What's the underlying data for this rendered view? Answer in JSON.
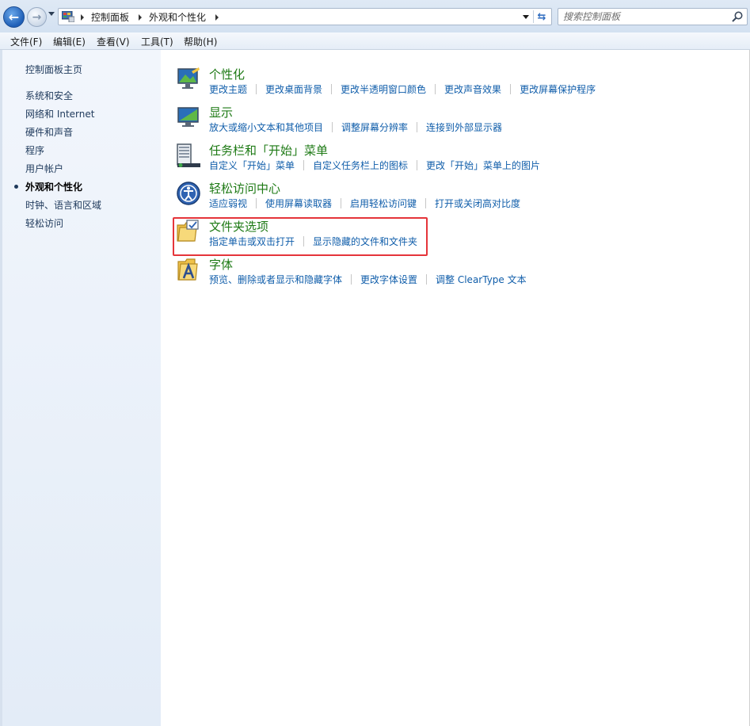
{
  "address_bar": {
    "breadcrumbs": [
      "控制面板",
      "外观和个性化"
    ],
    "search_placeholder": "搜索控制面板",
    "back_icon": "back-arrow-icon",
    "forward_icon": "forward-arrow-icon",
    "refresh_icon": "refresh-icon"
  },
  "menu": {
    "items": [
      "文件(F)",
      "编辑(E)",
      "查看(V)",
      "工具(T)",
      "帮助(H)"
    ]
  },
  "sidebar": {
    "home": "控制面板主页",
    "items": [
      {
        "label": "系统和安全",
        "active": false
      },
      {
        "label": "网络和 Internet",
        "active": false
      },
      {
        "label": "硬件和声音",
        "active": false
      },
      {
        "label": "程序",
        "active": false
      },
      {
        "label": "用户帐户",
        "active": false
      },
      {
        "label": "外观和个性化",
        "active": true
      },
      {
        "label": "时钟、语言和区域",
        "active": false
      },
      {
        "label": "轻松访问",
        "active": false
      }
    ]
  },
  "categories": [
    {
      "title": "个性化",
      "icon": "personalization-icon",
      "links": [
        "更改主题",
        "更改桌面背景",
        "更改半透明窗口颜色",
        "更改声音效果",
        "更改屏幕保护程序"
      ]
    },
    {
      "title": "显示",
      "icon": "display-icon",
      "links": [
        "放大或缩小文本和其他项目",
        "调整屏幕分辨率",
        "连接到外部显示器"
      ]
    },
    {
      "title": "任务栏和「开始」菜单",
      "icon": "taskbar-start-menu-icon",
      "links": [
        "自定义「开始」菜单",
        "自定义任务栏上的图标",
        "更改「开始」菜单上的图片"
      ]
    },
    {
      "title": "轻松访问中心",
      "icon": "ease-of-access-icon",
      "links": [
        "适应弱视",
        "使用屏幕读取器",
        "启用轻松访问键",
        "打开或关闭高对比度"
      ]
    },
    {
      "title": "文件夹选项",
      "icon": "folder-options-icon",
      "highlighted": true,
      "links": [
        "指定单击或双击打开",
        "显示隐藏的文件和文件夹"
      ]
    },
    {
      "title": "字体",
      "icon": "fonts-icon",
      "links": [
        "预览、删除或者显示和隐藏字体",
        "更改字体设置",
        "调整 ClearType 文本"
      ]
    }
  ],
  "colors": {
    "category_title": "#1e7a15",
    "link": "#0f5daa",
    "highlight_border": "#e5353a"
  }
}
